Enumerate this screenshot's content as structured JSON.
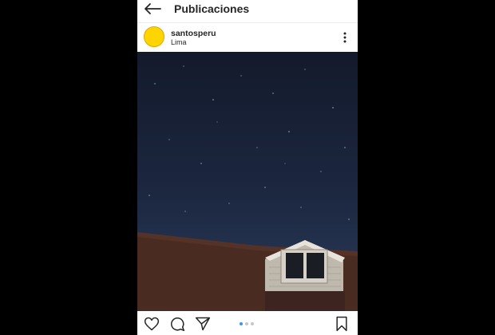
{
  "header": {
    "title": "Publicaciones"
  },
  "post": {
    "username": "santosperu",
    "location": "Lima",
    "avatar_color": "#ffd400",
    "carousel": {
      "total": 3,
      "active": 1
    }
  },
  "icons": {
    "back": "back-arrow-icon",
    "more": "more-options-icon",
    "like": "heart-icon",
    "comment": "comment-icon",
    "share": "send-icon",
    "save": "bookmark-icon"
  },
  "colors": {
    "accent": "#3897f0",
    "text": "#262626"
  }
}
